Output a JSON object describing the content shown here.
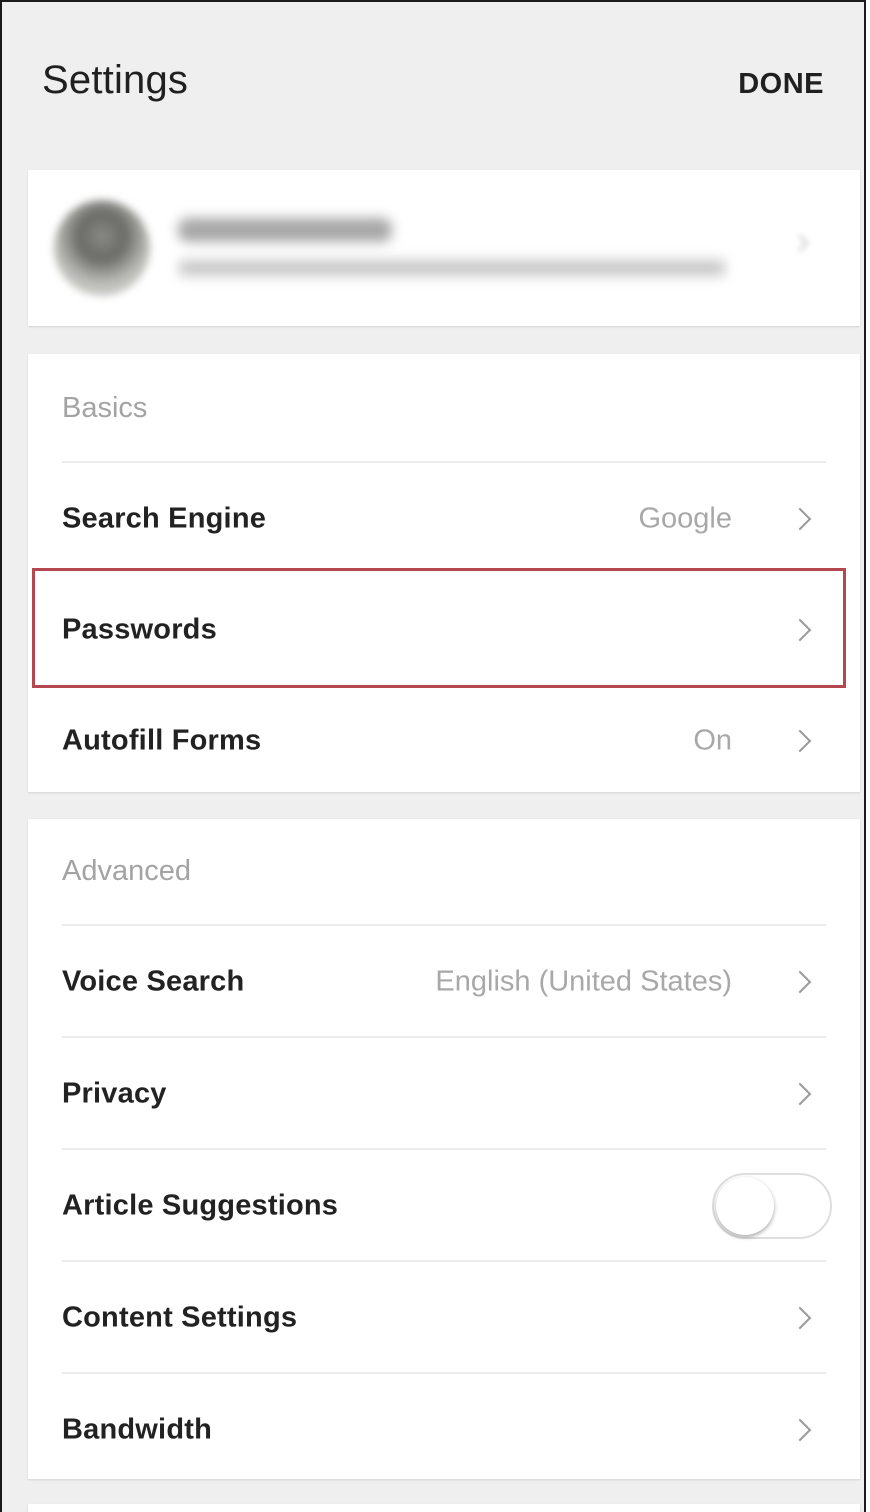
{
  "header": {
    "title": "Settings",
    "done_label": "DONE"
  },
  "account": {
    "name": "",
    "email": ""
  },
  "basics": {
    "header": "Basics",
    "items": [
      {
        "label": "Search Engine",
        "value": "Google"
      },
      {
        "label": "Passwords",
        "value": ""
      },
      {
        "label": "Autofill Forms",
        "value": "On"
      }
    ]
  },
  "advanced": {
    "header": "Advanced",
    "items": [
      {
        "label": "Voice Search",
        "value": "English (United States)"
      },
      {
        "label": "Privacy",
        "value": ""
      },
      {
        "label": "Article Suggestions",
        "toggle_on": false
      },
      {
        "label": "Content Settings",
        "value": ""
      },
      {
        "label": "Bandwidth",
        "value": ""
      }
    ]
  },
  "colors": {
    "highlight": "#b5474f",
    "background": "#efefef"
  }
}
